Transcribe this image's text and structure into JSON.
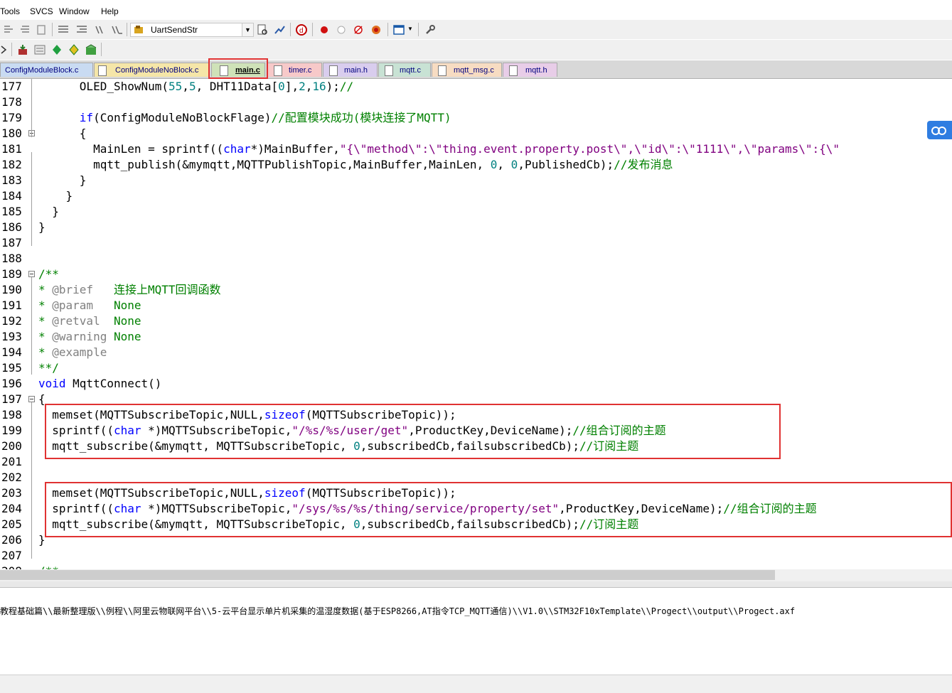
{
  "menu": {
    "items": [
      "Tools",
      "SVCS",
      "Window",
      "Help"
    ]
  },
  "toolbar": {
    "target_combo": "UartSendStr"
  },
  "tabs": [
    {
      "label": "ConfigModuleBlock.c",
      "color": "#c9dbf2",
      "active": false
    },
    {
      "label": "ConfigModuleNoBlock.c",
      "color": "#f5e6a8",
      "active": false
    },
    {
      "label": "main.c",
      "color": "#cfe2b8",
      "active": true
    },
    {
      "label": "timer.c",
      "color": "#f7c9c9",
      "active": false
    },
    {
      "label": "main.h",
      "color": "#d9cdee",
      "active": false
    },
    {
      "label": "mqtt.c",
      "color": "#c8e2d4",
      "active": false
    },
    {
      "label": "mqtt_msg.c",
      "color": "#f7dcc2",
      "active": false
    },
    {
      "label": "mqtt.h",
      "color": "#e8cde8",
      "active": false
    }
  ],
  "editor": {
    "lines": [
      {
        "num": "177",
        "tokens": [
          [
            "",
            "      OLED_ShowNum(",
            ""
          ],
          [
            "num",
            "55",
            ""
          ],
          [
            "",
            ",",
            ""
          ],
          [
            "num",
            "5",
            ""
          ],
          [
            "",
            ", DHT11Data[",
            ""
          ],
          [
            "num",
            "0",
            ""
          ],
          [
            "",
            "],",
            ""
          ],
          [
            "num",
            "2",
            ""
          ],
          [
            "",
            ",",
            ""
          ],
          [
            "num",
            "16",
            ""
          ],
          [
            "",
            ");",
            ""
          ],
          [
            "cm",
            "//",
            ""
          ]
        ]
      },
      {
        "num": "178",
        "tokens": []
      },
      {
        "num": "179",
        "tokens": [
          [
            "",
            "      ",
            ""
          ],
          [
            "kw",
            "if",
            ""
          ],
          [
            "",
            "(ConfigModuleNoBlockFlage)",
            ""
          ],
          [
            "cm",
            "//配置模块成功(模块连接了MQTT)",
            ""
          ]
        ]
      },
      {
        "num": "180",
        "fold": true,
        "tokens": [
          [
            "",
            "      {",
            ""
          ]
        ]
      },
      {
        "num": "181",
        "tokens": [
          [
            "",
            "        MainLen = sprintf((",
            ""
          ],
          [
            "kw",
            "char",
            ""
          ],
          [
            "",
            "*)MainBuffer,",
            ""
          ],
          [
            "str",
            "\"{\\\"method\\\":\\\"thing.event.property.post\\\",\\\"id\\\":\\\"1111\\\",\\\"params\\\":{\\\"",
            ""
          ]
        ]
      },
      {
        "num": "182",
        "tokens": [
          [
            "",
            "        mqtt_publish(&mymqtt,MQTTPublishTopic,MainBuffer,MainLen, ",
            ""
          ],
          [
            "num",
            "0",
            ""
          ],
          [
            "",
            ", ",
            ""
          ],
          [
            "num",
            "0",
            ""
          ],
          [
            "",
            ",PublishedCb);",
            ""
          ],
          [
            "cm",
            "//发布消息",
            ""
          ]
        ]
      },
      {
        "num": "183",
        "tokens": [
          [
            "",
            "      }",
            ""
          ]
        ]
      },
      {
        "num": "184",
        "tokens": [
          [
            "",
            "    }",
            ""
          ]
        ]
      },
      {
        "num": "185",
        "tokens": [
          [
            "",
            "  }",
            ""
          ]
        ]
      },
      {
        "num": "186",
        "tokens": [
          [
            "",
            "}",
            ""
          ]
        ]
      },
      {
        "num": "187",
        "tokens": []
      },
      {
        "num": "188",
        "tokens": []
      },
      {
        "num": "189",
        "fold": true,
        "tokens": [
          [
            "cm",
            "/**",
            ""
          ]
        ]
      },
      {
        "num": "190",
        "tokens": [
          [
            "cm",
            "* ",
            ""
          ],
          [
            "cmt",
            "@brief",
            ""
          ],
          [
            "cm",
            "   连接上MQTT回调函数",
            ""
          ]
        ]
      },
      {
        "num": "191",
        "tokens": [
          [
            "cm",
            "* ",
            ""
          ],
          [
            "cmt",
            "@param",
            ""
          ],
          [
            "cm",
            "   None",
            ""
          ]
        ]
      },
      {
        "num": "192",
        "tokens": [
          [
            "cm",
            "* ",
            ""
          ],
          [
            "cmt",
            "@retval",
            ""
          ],
          [
            "cm",
            "  None",
            ""
          ]
        ]
      },
      {
        "num": "193",
        "tokens": [
          [
            "cm",
            "* ",
            ""
          ],
          [
            "cmt",
            "@warning",
            ""
          ],
          [
            "cm",
            " None",
            ""
          ]
        ]
      },
      {
        "num": "194",
        "tokens": [
          [
            "cm",
            "* ",
            ""
          ],
          [
            "cmt",
            "@example",
            ""
          ]
        ]
      },
      {
        "num": "195",
        "tokens": [
          [
            "cm",
            "**/",
            ""
          ]
        ]
      },
      {
        "num": "196",
        "tokens": [
          [
            "kw",
            "void",
            ""
          ],
          [
            "",
            " MqttConnect()",
            ""
          ]
        ]
      },
      {
        "num": "197",
        "fold": true,
        "tokens": [
          [
            "",
            "{",
            ""
          ]
        ]
      },
      {
        "num": "198",
        "tokens": [
          [
            "",
            "  memset(MQTTSubscribeTopic,NULL,",
            ""
          ],
          [
            "kw",
            "sizeof",
            ""
          ],
          [
            "",
            "(MQTTSubscribeTopic));",
            ""
          ]
        ]
      },
      {
        "num": "199",
        "tokens": [
          [
            "",
            "  sprintf((",
            ""
          ],
          [
            "kw",
            "char",
            ""
          ],
          [
            "",
            " *)MQTTSubscribeTopic,",
            ""
          ],
          [
            "str",
            "\"/%s/%s/user/get\"",
            ""
          ],
          [
            "",
            ",ProductKey,DeviceName);",
            ""
          ],
          [
            "cm",
            "//组合订阅的主题",
            ""
          ]
        ]
      },
      {
        "num": "200",
        "tokens": [
          [
            "",
            "  mqtt_subscribe(&mymqtt, MQTTSubscribeTopic, ",
            ""
          ],
          [
            "num",
            "0",
            ""
          ],
          [
            "",
            ",subscribedCb,failsubscribedCb);",
            ""
          ],
          [
            "cm",
            "//订阅主题",
            ""
          ]
        ]
      },
      {
        "num": "201",
        "tokens": []
      },
      {
        "num": "202",
        "tokens": []
      },
      {
        "num": "203",
        "tokens": [
          [
            "",
            "  memset(MQTTSubscribeTopic,NULL,",
            ""
          ],
          [
            "kw",
            "sizeof",
            ""
          ],
          [
            "",
            "(MQTTSubscribeTopic));",
            ""
          ]
        ]
      },
      {
        "num": "204",
        "tokens": [
          [
            "",
            "  sprintf((",
            ""
          ],
          [
            "kw",
            "char",
            ""
          ],
          [
            "",
            " *)MQTTSubscribeTopic,",
            ""
          ],
          [
            "str",
            "\"/sys/%s/%s/thing/service/property/set\"",
            ""
          ],
          [
            "",
            ",ProductKey,DeviceName);",
            ""
          ],
          [
            "cm",
            "//组合订阅的主题",
            ""
          ]
        ]
      },
      {
        "num": "205",
        "tokens": [
          [
            "",
            "  mqtt_subscribe(&mymqtt, MQTTSubscribeTopic, ",
            ""
          ],
          [
            "num",
            "0",
            ""
          ],
          [
            "",
            ",subscribedCb,failsubscribedCb);",
            ""
          ],
          [
            "cm",
            "//订阅主题",
            ""
          ]
        ]
      },
      {
        "num": "206",
        "tokens": [
          [
            "",
            "}",
            ""
          ]
        ]
      },
      {
        "num": "207",
        "tokens": []
      },
      {
        "num": "208",
        "tokens": [
          [
            "cm",
            "/**",
            ""
          ]
        ]
      }
    ]
  },
  "output": {
    "text": "教程基础篇\\\\最新整理版\\\\例程\\\\阿里云物联网平台\\\\5-云平台显示单片机采集的温湿度数据(基于ESP8266,AT指令TCP_MQTT通信)\\\\V1.0\\\\STM32F10xTemplate\\\\Progect\\\\output\\\\Progect.axf"
  },
  "colors": {
    "keyword": "#0000ff",
    "comment": "#008000",
    "string": "#800080",
    "number": "#008080",
    "doc_tag": "#808080",
    "highlight": "#e03232"
  }
}
